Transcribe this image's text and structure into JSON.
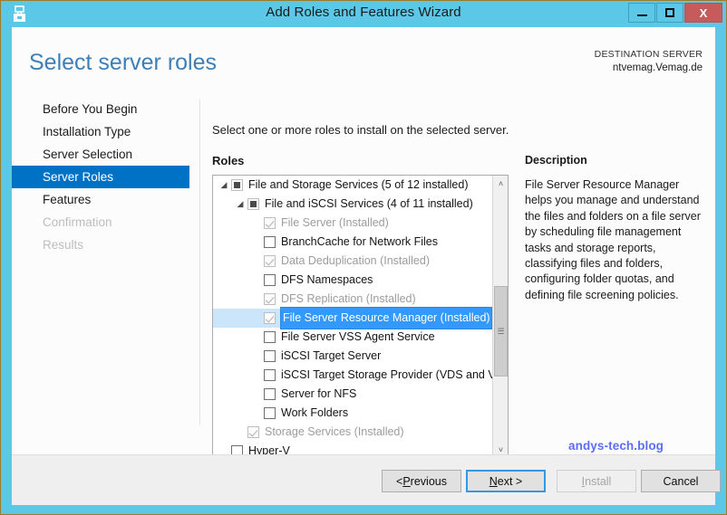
{
  "window": {
    "title": "Add Roles and Features Wizard",
    "icon": "server-wizard-icon",
    "minimize_label": "Minimize",
    "maximize_label": "Maximize",
    "close_label": "X",
    "border_color": "#5BC8E8",
    "close_color": "#C75B5B"
  },
  "header": {
    "page_title": "Select server roles",
    "destination_label": "DESTINATION SERVER",
    "destination_server": "ntvemag.Vemag.de",
    "title_color": "#3F7FB5"
  },
  "nav": {
    "selected_color": "#0072C6",
    "items": [
      {
        "label": "Before You Begin",
        "state": "normal"
      },
      {
        "label": "Installation Type",
        "state": "normal"
      },
      {
        "label": "Server Selection",
        "state": "normal"
      },
      {
        "label": "Server Roles",
        "state": "selected"
      },
      {
        "label": "Features",
        "state": "normal"
      },
      {
        "label": "Confirmation",
        "state": "disabled"
      },
      {
        "label": "Results",
        "state": "disabled"
      }
    ]
  },
  "main": {
    "instruction": "Select one or more roles to install on the selected server.",
    "roles_label": "Roles",
    "selection_highlight_color": "#3399FF",
    "selected_row_band_color": "#CBE6FA",
    "tree": [
      {
        "label": "File and Storage Services (5 of 12 installed)",
        "indent": 0,
        "twisty": "expanded",
        "check": "partial",
        "installed": false,
        "selected": false
      },
      {
        "label": "File and iSCSI Services (4 of 11 installed)",
        "indent": 1,
        "twisty": "expanded",
        "check": "partial",
        "installed": false,
        "selected": false
      },
      {
        "label": "File Server (Installed)",
        "indent": 2,
        "twisty": "none",
        "check": "checked",
        "installed": true,
        "selected": false
      },
      {
        "label": "BranchCache for Network Files",
        "indent": 2,
        "twisty": "none",
        "check": "unchecked",
        "installed": false,
        "selected": false
      },
      {
        "label": "Data Deduplication (Installed)",
        "indent": 2,
        "twisty": "none",
        "check": "checked",
        "installed": true,
        "selected": false
      },
      {
        "label": "DFS Namespaces",
        "indent": 2,
        "twisty": "none",
        "check": "unchecked",
        "installed": false,
        "selected": false
      },
      {
        "label": "DFS Replication (Installed)",
        "indent": 2,
        "twisty": "none",
        "check": "checked",
        "installed": true,
        "selected": false
      },
      {
        "label": "File Server Resource Manager (Installed)",
        "indent": 2,
        "twisty": "none",
        "check": "checked",
        "installed": true,
        "selected": true
      },
      {
        "label": "File Server VSS Agent Service",
        "indent": 2,
        "twisty": "none",
        "check": "unchecked",
        "installed": false,
        "selected": false
      },
      {
        "label": "iSCSI Target Server",
        "indent": 2,
        "twisty": "none",
        "check": "unchecked",
        "installed": false,
        "selected": false
      },
      {
        "label": "iSCSI Target Storage Provider (VDS and VSS",
        "indent": 2,
        "twisty": "none",
        "check": "unchecked",
        "installed": false,
        "selected": false
      },
      {
        "label": "Server for NFS",
        "indent": 2,
        "twisty": "none",
        "check": "unchecked",
        "installed": false,
        "selected": false
      },
      {
        "label": "Work Folders",
        "indent": 2,
        "twisty": "none",
        "check": "unchecked",
        "installed": false,
        "selected": false
      },
      {
        "label": "Storage Services (Installed)",
        "indent": 1,
        "twisty": "none",
        "check": "checked",
        "installed": true,
        "selected": false
      },
      {
        "label": "Hyper-V",
        "indent": 0,
        "twisty": "none",
        "check": "unchecked",
        "installed": false,
        "selected": false
      }
    ]
  },
  "description": {
    "title": "Description",
    "body": "File Server Resource Manager helps you manage and understand the files and folders on a file server by scheduling file management tasks and storage reports, classifying files and folders, configuring folder quotas, and defining file screening policies."
  },
  "watermark": {
    "text": "andys-tech.blog",
    "color": "#5B6EF5"
  },
  "footer": {
    "previous": "< Previous",
    "previous_mnemonic": "P",
    "next": "Next >",
    "next_mnemonic": "N",
    "install": "Install",
    "install_mnemonic": "I",
    "cancel": "Cancel",
    "install_enabled": false,
    "next_is_default": true
  },
  "scrollbars": {
    "vertical_up": "˄",
    "vertical_down": "˅",
    "horizontal_left": "‹",
    "horizontal_right": "›"
  }
}
